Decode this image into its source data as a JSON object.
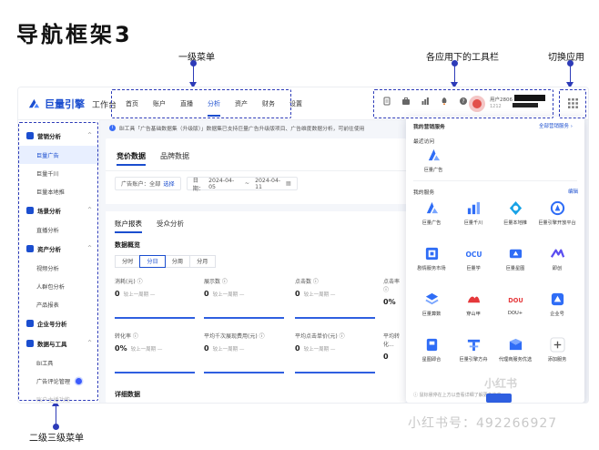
{
  "page_heading": "导航框架3",
  "annotations": {
    "primary_menu": "一级菜单",
    "app_toolbar": "各应用下的工具栏",
    "switch_app": "切换应用",
    "secondary_menu": "二级三级菜单"
  },
  "app": {
    "brand": "巨量引擎",
    "workspace": "工作台",
    "brand_color": "#1b4ecf"
  },
  "nav": {
    "items": [
      "首页",
      "账户",
      "直播",
      "分析",
      "资产",
      "财务",
      "设置"
    ],
    "active_index": 3
  },
  "toolbar": {
    "icons": [
      "document-icon",
      "briefcase-icon",
      "chart-icon",
      "rocket-icon",
      "help-icon"
    ],
    "user_name": "用户2806",
    "user_sub": "1212"
  },
  "sidebar": {
    "groups": [
      {
        "label": "营销分析",
        "chevron": "^",
        "items": [
          "巨量广告",
          "巨量千川",
          "巨量本地推"
        ]
      },
      {
        "label": "场景分析",
        "chevron": "^",
        "items": [
          "直播分析"
        ]
      },
      {
        "label": "资产分析",
        "chevron": "^",
        "items": [
          "视频分析",
          "人群包分析",
          "产品报表"
        ]
      },
      {
        "label": "企业号分析",
        "chevron": "",
        "items": []
      },
      {
        "label": "数据与工具",
        "chevron": "^",
        "items": [
          "BI工具",
          "广告评论管理",
          "账户主播功能"
        ]
      }
    ],
    "active_item": "巨量广告"
  },
  "notice": "BI工具「广告基础数据集（升级版）」数据集已支持巨量广告升级版项目、广告维度数据分析，可前往使用",
  "main": {
    "top_tabs": [
      "竞价数据",
      "品牌数据"
    ],
    "filter_account_label": "广告账户：",
    "filter_account_value": "全部",
    "filter_account_link": "选择",
    "filter_date_label": "日期：",
    "date_start": "2024-04-05",
    "date_end": "2024-04-11",
    "report_tabs": [
      "账户报表",
      "受众分析"
    ],
    "overview_title": "数据概览",
    "granularity": [
      "分时",
      "分日",
      "分周",
      "分月"
    ],
    "granularity_active": 1,
    "metrics_row1": [
      {
        "label": "消耗(元) ⓘ",
        "value": "0",
        "cmp": "较上一周期 —"
      },
      {
        "label": "展示数 ⓘ",
        "value": "0",
        "cmp": "较上一周期 —"
      },
      {
        "label": "点击数 ⓘ",
        "value": "0",
        "cmp": "较上一周期 —"
      },
      {
        "label": "点击率 ⓘ",
        "value": "0%",
        "cmp": "较上一周期 —"
      }
    ],
    "metrics_row2": [
      {
        "label": "转化率 ⓘ",
        "value": "0%",
        "cmp": "较上一周期 —"
      },
      {
        "label": "平均千次展现费用(元) ⓘ",
        "value": "0",
        "cmp": "较上一周期 —"
      },
      {
        "label": "平均点击单价(元) ⓘ",
        "value": "0",
        "cmp": "较上一周期 —"
      },
      {
        "label": "平均转化...",
        "value": "0",
        "cmp": ""
      }
    ],
    "detail_title": "详细数据"
  },
  "dropdown": {
    "title": "我的营销服务",
    "all_services_link": "全部营销服务 ›",
    "recent_title": "最近访问",
    "recent": [
      {
        "name": "巨量广告",
        "icon": "ocean-engine-icon",
        "color": "#2f6df6"
      }
    ],
    "my_services_title": "我的服务",
    "edit_link": "编辑",
    "services": [
      {
        "name": "巨量广告",
        "icon": "ocean-engine-icon",
        "color": "#2f6df6"
      },
      {
        "name": "巨量千川",
        "icon": "bar-chart-icon",
        "color": "#2f6df6"
      },
      {
        "name": "巨量本地推",
        "icon": "location-icon",
        "color": "#17a2e6"
      },
      {
        "name": "巨量引擎开放平台",
        "icon": "open-platform-icon",
        "color": "#2f6df6"
      },
      {
        "name": "剧情服务市场",
        "icon": "market-icon",
        "color": "#2f6df6"
      },
      {
        "name": "巨量学",
        "icon": "cloud-icon",
        "color": "#2f6df6"
      },
      {
        "name": "巨量星图",
        "icon": "star-map-icon",
        "color": "#2f6df6"
      },
      {
        "name": "即创",
        "icon": "create-icon",
        "color": "#5b4ef0"
      },
      {
        "name": "巨量算数",
        "icon": "layers-icon",
        "color": "#2f6df6"
      },
      {
        "name": "穿山甲",
        "icon": "pangolin-icon",
        "color": "#e5383b"
      },
      {
        "name": "DOU+",
        "icon": "dou-plus-icon",
        "color": "#e5383b"
      },
      {
        "name": "企业号",
        "icon": "enterprise-icon",
        "color": "#2f6df6"
      },
      {
        "name": "星图即合",
        "icon": "flag-icon",
        "color": "#2f6df6"
      },
      {
        "name": "巨量引擎方舟",
        "icon": "ark-icon",
        "color": "#2f6df6"
      },
      {
        "name": "代理商服务优选",
        "icon": "agency-icon",
        "color": "#2f6df6"
      },
      {
        "name": "添加服务",
        "icon": "plus-icon",
        "color": "#555555"
      }
    ],
    "footer": "ⓘ 鼠标悬停在上方以查看详细了解更多信息"
  },
  "watermark_small": "小红书",
  "watermark": "小红书号：492266927"
}
